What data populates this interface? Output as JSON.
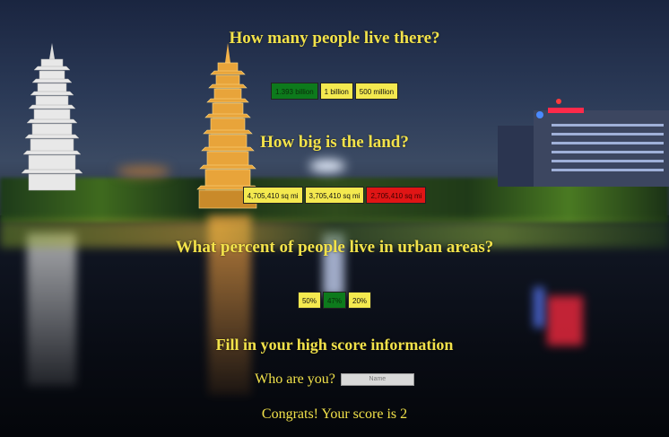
{
  "questions": [
    {
      "title": "How many people live there?",
      "options": [
        {
          "label": "1.393 billion",
          "state": "correct"
        },
        {
          "label": "1 billion",
          "state": "neutral"
        },
        {
          "label": "500 million",
          "state": "neutral"
        }
      ]
    },
    {
      "title": "How big is the land?",
      "options": [
        {
          "label": "4,705,410 sq mi",
          "state": "neutral"
        },
        {
          "label": "3,705,410 sq mi",
          "state": "neutral"
        },
        {
          "label": "2,705,410 sq mi",
          "state": "wrong"
        }
      ]
    },
    {
      "title": "What percent of people live in urban areas?",
      "options": [
        {
          "label": "50%",
          "state": "neutral"
        },
        {
          "label": "47%",
          "state": "correct"
        },
        {
          "label": "20%",
          "state": "neutral"
        }
      ]
    }
  ],
  "highscore": {
    "title": "Fill in your high score information",
    "who_label": "Who are you?",
    "name_placeholder": "Name",
    "congrats": "Congrats! Your score is 2"
  },
  "colors": {
    "button": "#f4e94f",
    "correct": "#0d7a1c",
    "wrong": "#e01515",
    "text": "#f2e24a"
  }
}
